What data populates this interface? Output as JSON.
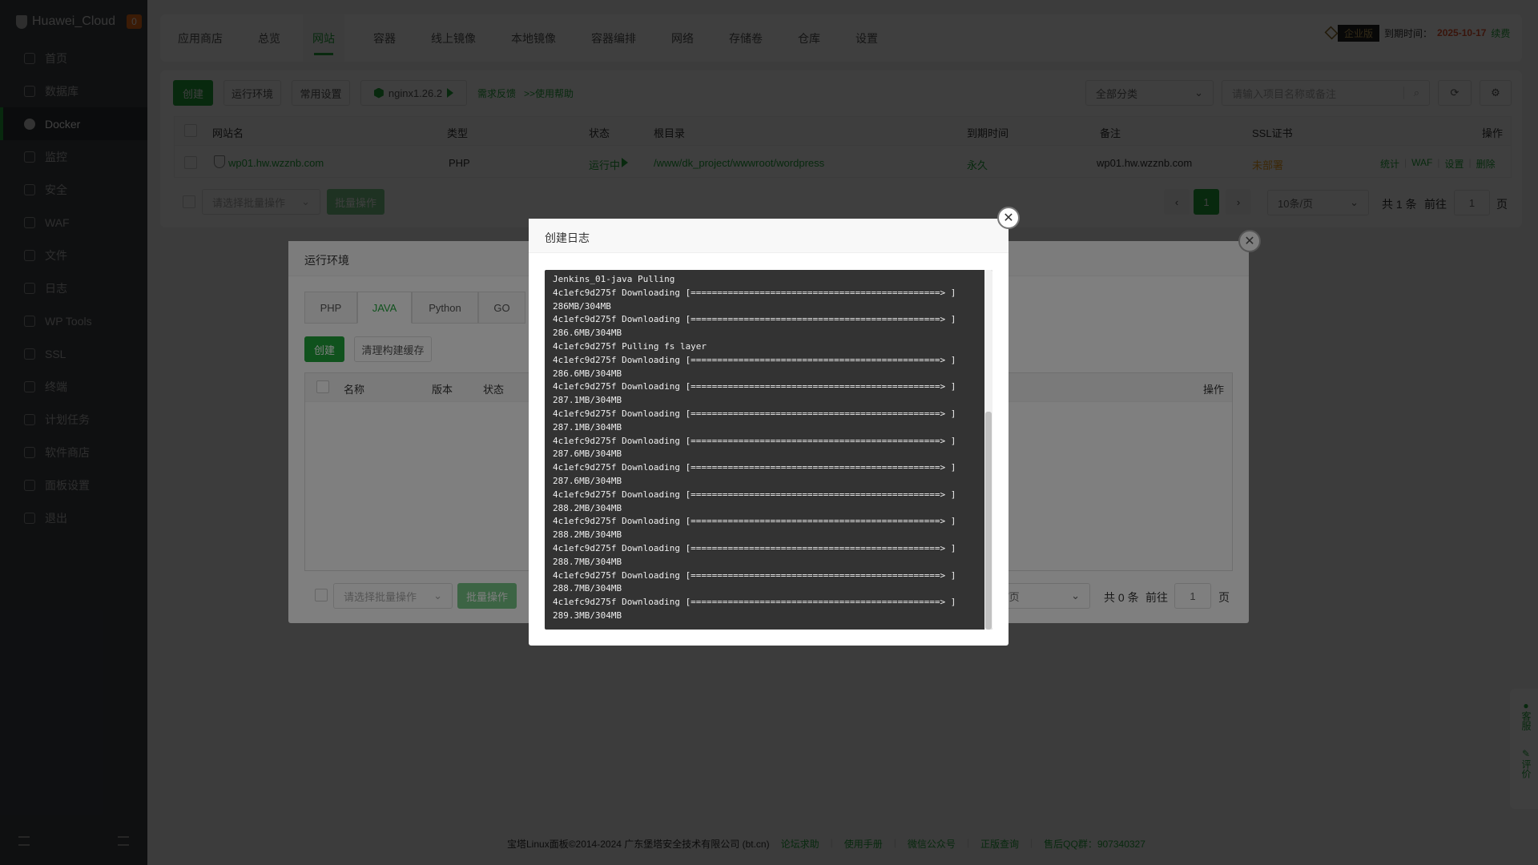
{
  "sidebar": {
    "brand": "Huawei_Cloud",
    "badge": "0",
    "items": [
      {
        "label": "首页"
      },
      {
        "label": "数据库"
      },
      {
        "label": "Docker"
      },
      {
        "label": "监控"
      },
      {
        "label": "安全"
      },
      {
        "label": "WAF"
      },
      {
        "label": "文件"
      },
      {
        "label": "日志"
      },
      {
        "label": "WP Tools"
      },
      {
        "label": "SSL"
      },
      {
        "label": "终端"
      },
      {
        "label": "计划任务"
      },
      {
        "label": "软件商店"
      },
      {
        "label": "面板设置"
      },
      {
        "label": "退出"
      }
    ],
    "active": "Docker"
  },
  "topnav": {
    "tabs": [
      "应用商店",
      "总览",
      "网站",
      "容器",
      "线上镜像",
      "本地镜像",
      "容器编排",
      "网络",
      "存储卷",
      "仓库",
      "设置"
    ],
    "active": "网站",
    "edition": "企业版",
    "expire_label": "到期时间：",
    "expire_date": "2025-10-17",
    "renew": "续费"
  },
  "toolbar": {
    "create": "创建",
    "runtime": "运行环境",
    "common_settings": "常用设置",
    "nginx": "nginx1.26.2",
    "feedback": "需求反馈",
    "help": ">>使用帮助",
    "category": "全部分类",
    "search_placeholder": "请输入项目名称或备注"
  },
  "table": {
    "headers": {
      "name": "网站名",
      "type": "类型",
      "status": "状态",
      "root": "根目录",
      "expire": "到期时间",
      "remark": "备注",
      "ssl": "SSL证书",
      "ops": "操作"
    },
    "rows": [
      {
        "name": "wp01.hw.wzznb.com",
        "type": "PHP",
        "status": "运行中",
        "root": "/www/dk_project/wwwroot/wordpress",
        "expire": "永久",
        "remark": "wp01.hw.wzznb.com",
        "ssl": "未部署",
        "ops": [
          "统计",
          "WAF",
          "设置",
          "删除"
        ]
      }
    ]
  },
  "batch": {
    "placeholder": "请选择批量操作",
    "button": "批量操作"
  },
  "pagination": {
    "page": "1",
    "per_page": "10条/页",
    "total": "共 1 条",
    "goto": "前往",
    "goto_value": "1",
    "page_unit": "页"
  },
  "env_dialog": {
    "title": "运行环境",
    "tabs": [
      "PHP",
      "JAVA",
      "Python",
      "GO"
    ],
    "active_tab": "JAVA",
    "create": "创建",
    "clear_cache": "清理构建缓存",
    "headers": {
      "name": "名称",
      "version": "版本",
      "status": "状态",
      "ops": "操作"
    },
    "batch_placeholder": "请选择批量操作",
    "batch_button": "批量操作",
    "per_page": "条/页",
    "total": "共 0 条",
    "goto": "前往",
    "goto_value": "1",
    "page_unit": "页"
  },
  "log_dialog": {
    "title": "创建日志",
    "lines": [
      "Jenkins_01-java Pulling",
      "4c1efc9d275f Downloading [===============================================> ]",
      "286MB/304MB",
      "4c1efc9d275f Downloading [===============================================> ]",
      "286.6MB/304MB",
      "4c1efc9d275f Pulling fs layer",
      "4c1efc9d275f Downloading [===============================================> ]",
      "286.6MB/304MB",
      "4c1efc9d275f Downloading [===============================================> ]",
      "287.1MB/304MB",
      "4c1efc9d275f Downloading [===============================================> ]",
      "287.1MB/304MB",
      "4c1efc9d275f Downloading [===============================================> ]",
      "287.6MB/304MB",
      "4c1efc9d275f Downloading [===============================================> ]",
      "287.6MB/304MB",
      "4c1efc9d275f Downloading [===============================================> ]",
      "288.2MB/304MB",
      "4c1efc9d275f Downloading [===============================================> ]",
      "288.2MB/304MB",
      "4c1efc9d275f Downloading [===============================================> ]",
      "288.7MB/304MB",
      "4c1efc9d275f Downloading [===============================================> ]",
      "288.7MB/304MB",
      "4c1efc9d275f Downloading [===============================================> ]",
      "289.3MB/304MB"
    ]
  },
  "footer": {
    "copyright": "宝塔Linux面板©2014-2024 广东堡塔安全技术有限公司 (bt.cn)",
    "links": [
      "论坛求助",
      "使用手册",
      "微信公众号",
      "正版查询",
      "售后QQ群：907340327"
    ]
  },
  "float": {
    "service": "客服",
    "review": "评价"
  },
  "colors": {
    "accent": "#20a53a",
    "expire_date": "#e5532d",
    "ssl_pending": "#f0a020"
  }
}
